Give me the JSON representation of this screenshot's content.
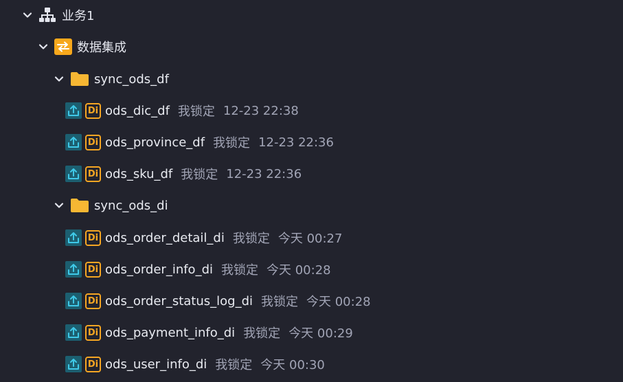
{
  "tree": {
    "business": {
      "label": "业务1",
      "icon": "org-hierarchy-icon",
      "expanded": true
    },
    "integration": {
      "label": "数据集成",
      "icon": "swap-arrows-icon",
      "icon_bg": "#f7a81c",
      "expanded": true
    },
    "folders": [
      {
        "label": "sync_ods_df",
        "icon": "folder-icon",
        "expanded": true,
        "tasks": [
          {
            "name": "ods_dic_df",
            "owner": "我锁定",
            "time": "12-23 22:38",
            "type_badge": "Di"
          },
          {
            "name": "ods_province_df",
            "owner": "我锁定",
            "time": "12-23 22:36",
            "type_badge": "Di"
          },
          {
            "name": "ods_sku_df",
            "owner": "我锁定",
            "time": "12-23 22:36",
            "type_badge": "Di"
          }
        ]
      },
      {
        "label": "sync_ods_di",
        "icon": "folder-icon",
        "expanded": true,
        "tasks": [
          {
            "name": "ods_order_detail_di",
            "owner": "我锁定",
            "time": "今天 00:27",
            "type_badge": "Di"
          },
          {
            "name": "ods_order_info_di",
            "owner": "我锁定",
            "time": "今天 00:28",
            "type_badge": "Di"
          },
          {
            "name": "ods_order_status_log_di",
            "owner": "我锁定",
            "time": "今天 00:28",
            "type_badge": "Di"
          },
          {
            "name": "ods_payment_info_di",
            "owner": "我锁定",
            "time": "今天 00:29",
            "type_badge": "Di"
          },
          {
            "name": "ods_user_info_di",
            "owner": "我锁定",
            "time": "今天 00:30",
            "type_badge": "Di"
          }
        ]
      }
    ]
  },
  "colors": {
    "background": "#22232d",
    "text_primary": "#e8eaf0",
    "text_secondary": "#a1a4b5",
    "folder": "#f7b733",
    "di_badge": "#f5a623",
    "upload_icon_bg": "#1c5f70",
    "upload_icon_fg": "#3fc9e8"
  }
}
